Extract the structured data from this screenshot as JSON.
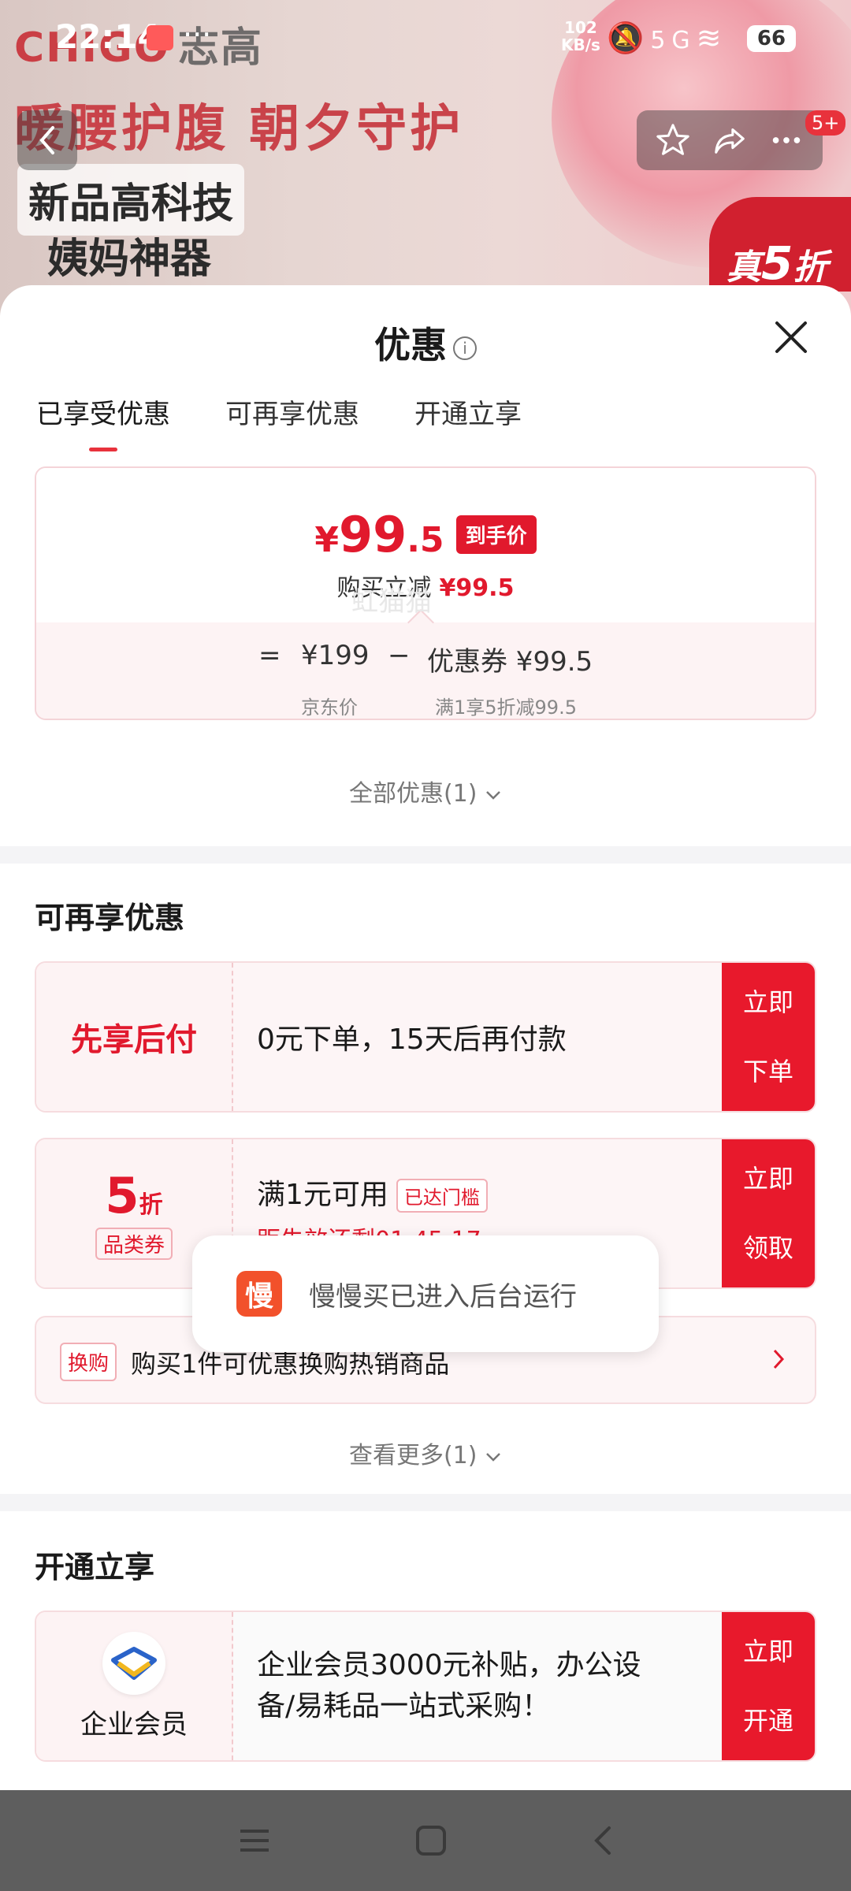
{
  "status_bar": {
    "time": "22:14",
    "dots": "···",
    "net_speed_value": "102",
    "net_speed_unit": "KB/s",
    "signal_label": "5G",
    "battery": "66"
  },
  "banner": {
    "brand_en": "CHIGO",
    "brand_cn": "志高",
    "headline": "暖腰护腹 朝夕守护",
    "tag_line1": "新品高科技",
    "tag_line2": "姨妈神器",
    "corner_prefix": "真",
    "corner_num": "5",
    "corner_suffix": "折",
    "badge": "5+"
  },
  "sheet": {
    "title": "优惠",
    "tabs": [
      {
        "label": "已享受优惠",
        "active": true
      },
      {
        "label": "可再享优惠",
        "active": false
      },
      {
        "label": "开通立享",
        "active": false
      }
    ]
  },
  "price_card": {
    "yen": "¥",
    "price_int": "99",
    "price_dec": ".5",
    "price_tag": "到手价",
    "sub_label": "购买立减",
    "sub_value": "¥99.5",
    "eq": "=",
    "jd_price": "¥199",
    "minus": "−",
    "coupon": "优惠券 ¥99.5",
    "jd_label": "京东价",
    "coupon_label": "满1享5折减99.5"
  },
  "all_offers": "全部优惠(1)",
  "more_section": {
    "title": "可再享优惠",
    "watermark": "虹猫猫",
    "pay_later": {
      "left": "先享后付",
      "text": "0元下单，15天后再付款",
      "cta_line1": "立即",
      "cta_line2": "下单"
    },
    "coupon": {
      "num": "5",
      "unit": "折",
      "tag": "品类券",
      "text": "满1元可用",
      "reach_tag": "已达门槛",
      "countdown": "距失效还剩01:45:17",
      "cta_line1": "立即",
      "cta_line2": "领取"
    },
    "exchange": {
      "tag": "换购",
      "text": "购买1件可优惠换购热销商品"
    },
    "see_more": "查看更多(1)"
  },
  "open_section": {
    "title": "开通立享",
    "vip": {
      "label": "企业会员",
      "text_line1": "企业会员3000元补贴，办公设",
      "text_line2": "备/易耗品一站式采购！",
      "cta_line1": "立即",
      "cta_line2": "开通"
    }
  },
  "toast": {
    "app_char": "慢",
    "message": "慢慢买已进入后台运行"
  },
  "colors": {
    "accent_red": "#e1192d",
    "cta_red": "#e8192c",
    "light_pink": "#fdf3f4"
  }
}
